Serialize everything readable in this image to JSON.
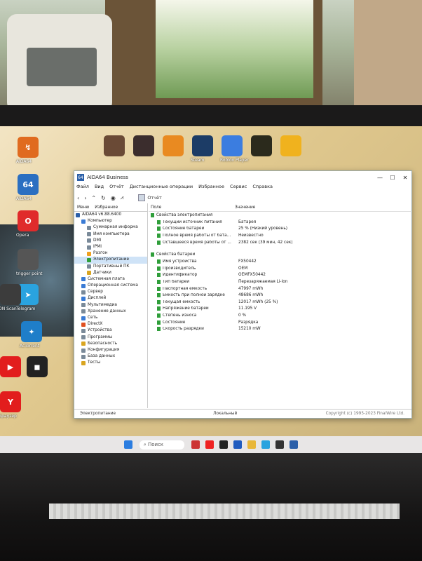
{
  "desktop_icons": [
    {
      "id": "aida-desktop",
      "label": "AIDA64",
      "text": "↯",
      "color": "#e06b1f"
    },
    {
      "id": "sixtyfour",
      "label": "AIDA64",
      "text": "64",
      "color": "#2b6fc1"
    },
    {
      "id": "opera",
      "label": "Opera",
      "text": "O",
      "color": "#e02b2b"
    },
    {
      "id": "telegram",
      "label": "Telegram",
      "text": "➤",
      "color": "#2aa3df"
    },
    {
      "id": "trigger",
      "label": "trigger point",
      "text": "",
      "color": "#555"
    },
    {
      "id": "onscan",
      "label": "ON Scan",
      "text": "",
      "color": "#3c3c3c"
    },
    {
      "id": "acronet",
      "label": "AcTorrent",
      "text": "✦",
      "color": "#1f7ec9"
    },
    {
      "id": "youtube",
      "label": "",
      "text": "▶",
      "color": "#e21d1d"
    },
    {
      "id": "roblox",
      "label": "",
      "text": "◼",
      "color": "#222"
    },
    {
      "id": "yandex",
      "label": "Браузер",
      "text": "Y",
      "color": "#e21d1d"
    }
  ],
  "top_icons": [
    {
      "id": "top1",
      "label": "",
      "color": "#6a4a36"
    },
    {
      "id": "top2",
      "label": "",
      "color": "#3b2d2d"
    },
    {
      "id": "top3",
      "label": "",
      "color": "#e98a21"
    },
    {
      "id": "steam",
      "label": "Steam",
      "color": "#1c3c66"
    },
    {
      "id": "roblox-player",
      "label": "Roblox Player",
      "color": "#3b7de0"
    },
    {
      "id": "codmw",
      "label": "",
      "color": "#2b2a1c"
    },
    {
      "id": "cs",
      "label": "",
      "color": "#f0b21e"
    }
  ],
  "window": {
    "title": "AIDA64 Business",
    "menu": [
      "Файл",
      "Вид",
      "Отчёт",
      "Дистанционные операции",
      "Избранное",
      "Сервис",
      "Справка"
    ],
    "toolbar_report": "Отчёт",
    "tabs": [
      "Меню",
      "Избранное"
    ],
    "tree": [
      {
        "label": "AIDA64 v6.88.6400",
        "indent": 0,
        "color": "#2b5fa8"
      },
      {
        "label": "Компьютер",
        "indent": 1,
        "color": "#3a7bd5"
      },
      {
        "label": "Суммарная информа",
        "indent": 2,
        "color": "#7a8a99"
      },
      {
        "label": "Имя компьютера",
        "indent": 2,
        "color": "#7a8a99"
      },
      {
        "label": "DMI",
        "indent": 2,
        "color": "#7a8a99"
      },
      {
        "label": "IPMI",
        "indent": 2,
        "color": "#7a8a99"
      },
      {
        "label": "Разгон",
        "indent": 2,
        "color": "#f0a020"
      },
      {
        "label": "Электропитание",
        "indent": 2,
        "color": "#2f9e3a",
        "selected": true
      },
      {
        "label": "Портативный ПК",
        "indent": 2,
        "color": "#7a8a99"
      },
      {
        "label": "Датчики",
        "indent": 2,
        "color": "#d9a520"
      },
      {
        "label": "Системная плата",
        "indent": 1,
        "color": "#3a7bd5"
      },
      {
        "label": "Операционная система",
        "indent": 1,
        "color": "#3a7bd5"
      },
      {
        "label": "Сервер",
        "indent": 1,
        "color": "#7a8a99"
      },
      {
        "label": "Дисплей",
        "indent": 1,
        "color": "#3a7bd5"
      },
      {
        "label": "Мультимедиа",
        "indent": 1,
        "color": "#7a8a99"
      },
      {
        "label": "Хранение данных",
        "indent": 1,
        "color": "#7a8a99"
      },
      {
        "label": "Сеть",
        "indent": 1,
        "color": "#3a7bd5"
      },
      {
        "label": "DirectX",
        "indent": 1,
        "color": "#e05020"
      },
      {
        "label": "Устройства",
        "indent": 1,
        "color": "#7a8a99"
      },
      {
        "label": "Программы",
        "indent": 1,
        "color": "#7a8a99"
      },
      {
        "label": "Безопасность",
        "indent": 1,
        "color": "#d9a520"
      },
      {
        "label": "Конфигурация",
        "indent": 1,
        "color": "#7a8a99"
      },
      {
        "label": "База данных",
        "indent": 1,
        "color": "#7a8a99"
      },
      {
        "label": "Тесты",
        "indent": 1,
        "color": "#d9a520"
      }
    ],
    "columns": {
      "field": "Поле",
      "value": "Значение"
    },
    "sections": [
      {
        "title": "Свойства электропитания",
        "rows": [
          {
            "field": "Текущий источник питания",
            "value": "Батарея"
          },
          {
            "field": "Состояние батарей",
            "value": "25 % (Низкий уровень)"
          },
          {
            "field": "Полное время работы от бата...",
            "value": "Неизвестно"
          },
          {
            "field": "Оставшееся время работы от ...",
            "value": "2382 сек (39 мин, 42 сек)"
          }
        ]
      },
      {
        "title": "Свойства батареи",
        "rows": [
          {
            "field": "Имя устройства",
            "value": "FX50442"
          },
          {
            "field": "Производитель",
            "value": "OEM"
          },
          {
            "field": "Идентификатор",
            "value": "OEMFX50442"
          },
          {
            "field": "Тип батареи",
            "value": "Перезаряжаемая Li-Ion"
          },
          {
            "field": "Паспортная ёмкость",
            "value": "47997 mWh"
          },
          {
            "field": "Ёмкость при полной зарядке",
            "value": "48686 mWh"
          },
          {
            "field": "Текущая ёмкость",
            "value": "12017 mWh  (25 %)"
          },
          {
            "field": "Напряжение батареи",
            "value": "11.195 V"
          },
          {
            "field": "Степень износа",
            "value": "0 %"
          },
          {
            "field": "Состояние",
            "value": "Разрядка"
          },
          {
            "field": "Скорость разрядки",
            "value": "15210 mW"
          }
        ]
      }
    ],
    "status": {
      "left": "Электропитание",
      "mid": "Локальный",
      "right": "Copyright (c) 1995-2023 FinalWire Ltd."
    }
  },
  "taskbar": {
    "search_label": "Поиск"
  }
}
